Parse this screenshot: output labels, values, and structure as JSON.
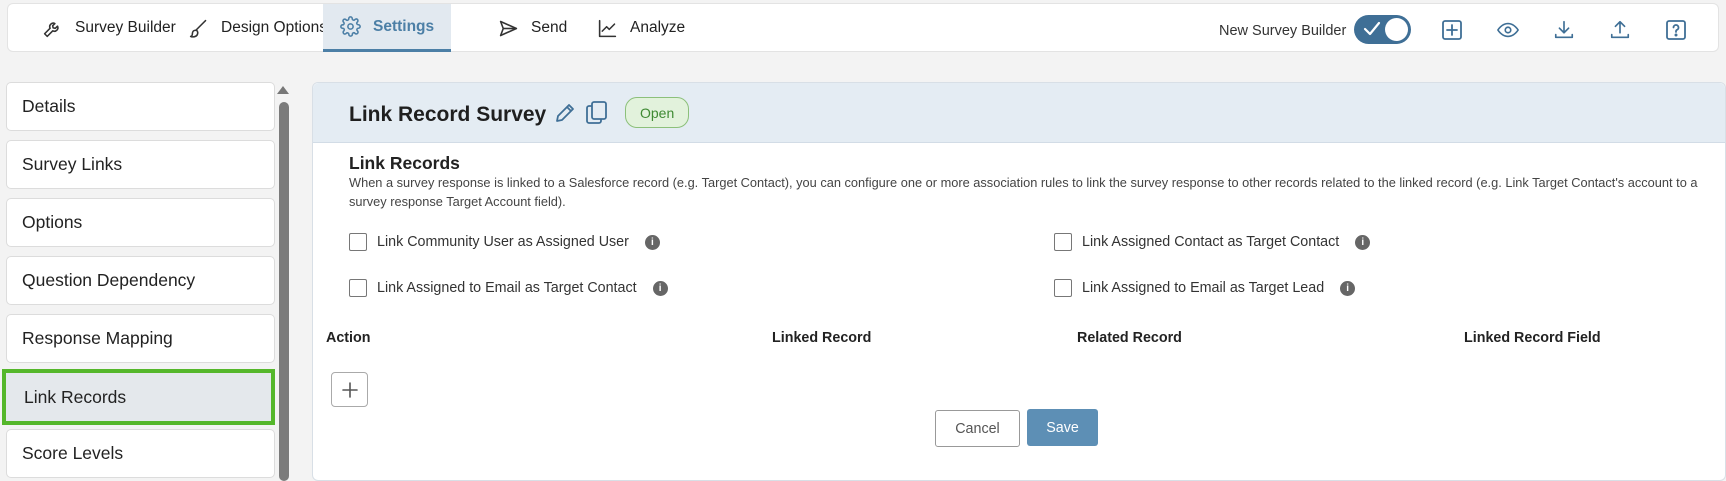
{
  "topnav": {
    "tabs": [
      {
        "label": "Survey Builder",
        "icon": "wrench-icon"
      },
      {
        "label": "Design Options",
        "icon": "brush-icon"
      },
      {
        "label": "Settings",
        "icon": "gear-icon",
        "active": true
      },
      {
        "label": "Send",
        "icon": "send-icon"
      },
      {
        "label": "Analyze",
        "icon": "chart-line-icon"
      }
    ],
    "toggle_label": "New Survey Builder",
    "toggle_on": true,
    "tools": [
      "plus-square-icon",
      "eye-icon",
      "download-icon",
      "upload-icon",
      "help-icon"
    ]
  },
  "sidebar": {
    "items": [
      {
        "label": "Details"
      },
      {
        "label": "Survey Links"
      },
      {
        "label": "Options"
      },
      {
        "label": "Question Dependency"
      },
      {
        "label": "Response Mapping"
      },
      {
        "label": "Link Records",
        "active": true
      },
      {
        "label": "Score Levels"
      }
    ]
  },
  "main": {
    "survey_title": "Link Record Survey",
    "status": "Open",
    "section_title": "Link Records",
    "section_desc": "When a survey response is linked to a Salesforce record (e.g. Target Contact), you can configure one or more association rules to link the survey response to other records related to the linked record (e.g. Link Target Contact's account to a survey response Target Account field).",
    "checkboxes": [
      {
        "label": "Link Community User as Assigned User",
        "checked": false
      },
      {
        "label": "Link Assigned Contact as Target Contact",
        "checked": false
      },
      {
        "label": "Link Assigned to Email as Target Contact",
        "checked": false
      },
      {
        "label": "Link Assigned to Email as Target Lead",
        "checked": false
      }
    ],
    "columns": [
      "Action",
      "Linked Record",
      "Related Record",
      "Linked Record Field"
    ],
    "cancel_label": "Cancel",
    "save_label": "Save"
  },
  "colors": {
    "accent": "#4c7fa6",
    "selected_outline": "#55b72b",
    "status_green": "#3f8a33",
    "save_button": "#5d8fb5"
  }
}
